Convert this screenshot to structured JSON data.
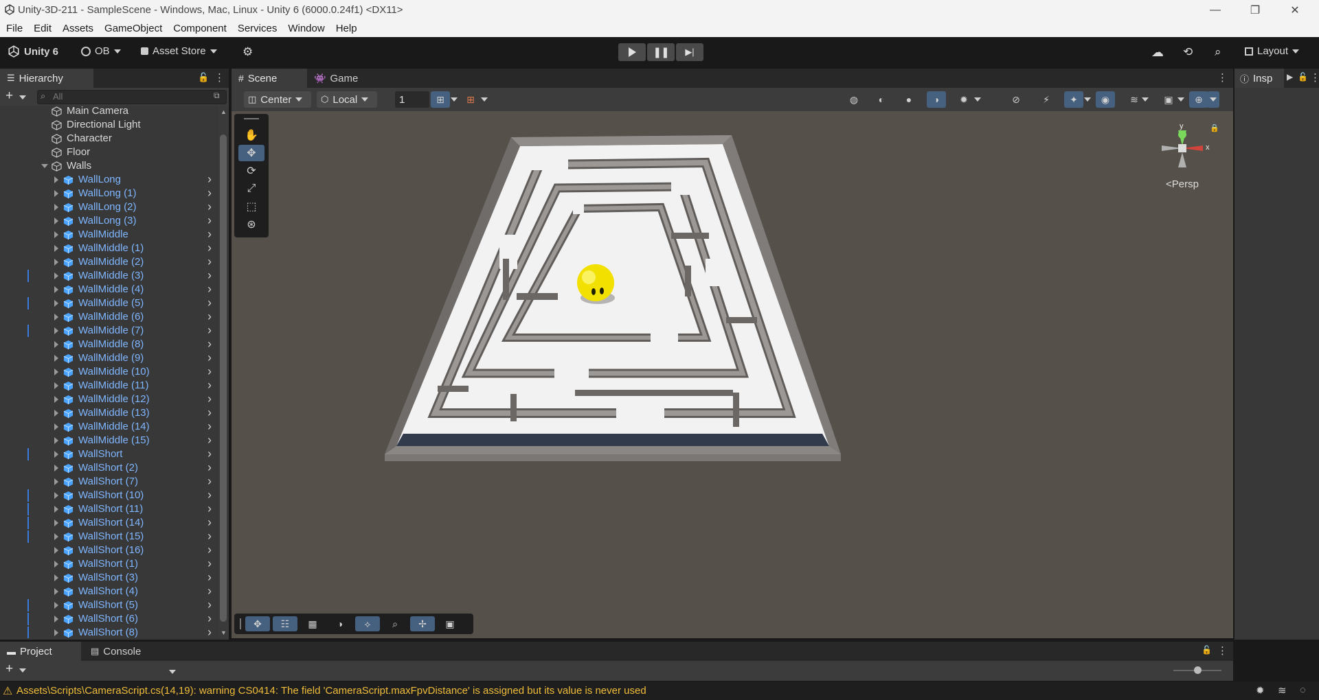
{
  "window": {
    "title": "Unity-3D-211 - SampleScene - Windows, Mac, Linux - Unity 6 (6000.0.24f1) <DX11>"
  },
  "menu": [
    "File",
    "Edit",
    "Assets",
    "GameObject",
    "Component",
    "Services",
    "Window",
    "Help"
  ],
  "toolbar": {
    "unity_label": "Unity 6",
    "account_label": "OB",
    "asset_store_label": "Asset Store",
    "layout_label": "Layout"
  },
  "hierarchy": {
    "tab_label": "Hierarchy",
    "search_placeholder": "All",
    "items": [
      {
        "name": "Main Camera",
        "depth": 1,
        "type": "object"
      },
      {
        "name": "Directional Light",
        "depth": 1,
        "type": "object"
      },
      {
        "name": "Character",
        "depth": 1,
        "type": "object"
      },
      {
        "name": "Floor",
        "depth": 1,
        "type": "object"
      },
      {
        "name": "Walls",
        "depth": 1,
        "type": "parent"
      },
      {
        "name": "WallLong",
        "depth": 2,
        "type": "prefab",
        "mark": false
      },
      {
        "name": "WallLong (1)",
        "depth": 2,
        "type": "prefab",
        "mark": false
      },
      {
        "name": "WallLong (2)",
        "depth": 2,
        "type": "prefab",
        "mark": false
      },
      {
        "name": "WallLong (3)",
        "depth": 2,
        "type": "prefab",
        "mark": false
      },
      {
        "name": "WallMiddle",
        "depth": 2,
        "type": "prefab",
        "mark": false
      },
      {
        "name": "WallMiddle (1)",
        "depth": 2,
        "type": "prefab",
        "mark": false
      },
      {
        "name": "WallMiddle (2)",
        "depth": 2,
        "type": "prefab",
        "mark": false
      },
      {
        "name": "WallMiddle (3)",
        "depth": 2,
        "type": "prefab",
        "mark": true
      },
      {
        "name": "WallMiddle (4)",
        "depth": 2,
        "type": "prefab",
        "mark": false
      },
      {
        "name": "WallMiddle (5)",
        "depth": 2,
        "type": "prefab",
        "mark": true
      },
      {
        "name": "WallMiddle (6)",
        "depth": 2,
        "type": "prefab",
        "mark": false
      },
      {
        "name": "WallMiddle (7)",
        "depth": 2,
        "type": "prefab",
        "mark": true
      },
      {
        "name": "WallMiddle (8)",
        "depth": 2,
        "type": "prefab",
        "mark": false
      },
      {
        "name": "WallMiddle (9)",
        "depth": 2,
        "type": "prefab",
        "mark": false
      },
      {
        "name": "WallMiddle (10)",
        "depth": 2,
        "type": "prefab",
        "mark": false
      },
      {
        "name": "WallMiddle (11)",
        "depth": 2,
        "type": "prefab",
        "mark": false
      },
      {
        "name": "WallMiddle (12)",
        "depth": 2,
        "type": "prefab",
        "mark": false
      },
      {
        "name": "WallMiddle (13)",
        "depth": 2,
        "type": "prefab",
        "mark": false
      },
      {
        "name": "WallMiddle (14)",
        "depth": 2,
        "type": "prefab",
        "mark": false
      },
      {
        "name": "WallMiddle (15)",
        "depth": 2,
        "type": "prefab",
        "mark": false
      },
      {
        "name": "WallShort",
        "depth": 2,
        "type": "prefab",
        "mark": true
      },
      {
        "name": "WallShort (2)",
        "depth": 2,
        "type": "prefab",
        "mark": false
      },
      {
        "name": "WallShort (7)",
        "depth": 2,
        "type": "prefab",
        "mark": false
      },
      {
        "name": "WallShort (10)",
        "depth": 2,
        "type": "prefab",
        "mark": true
      },
      {
        "name": "WallShort (11)",
        "depth": 2,
        "type": "prefab",
        "mark": true
      },
      {
        "name": "WallShort (14)",
        "depth": 2,
        "type": "prefab",
        "mark": true
      },
      {
        "name": "WallShort (15)",
        "depth": 2,
        "type": "prefab",
        "mark": true
      },
      {
        "name": "WallShort (16)",
        "depth": 2,
        "type": "prefab",
        "mark": false
      },
      {
        "name": "WallShort (1)",
        "depth": 2,
        "type": "prefab",
        "mark": false
      },
      {
        "name": "WallShort (3)",
        "depth": 2,
        "type": "prefab",
        "mark": false
      },
      {
        "name": "WallShort (4)",
        "depth": 2,
        "type": "prefab",
        "mark": false
      },
      {
        "name": "WallShort (5)",
        "depth": 2,
        "type": "prefab",
        "mark": true
      },
      {
        "name": "WallShort (6)",
        "depth": 2,
        "type": "prefab",
        "mark": true
      },
      {
        "name": "WallShort (8)",
        "depth": 2,
        "type": "prefab",
        "mark": true
      }
    ]
  },
  "scene": {
    "tab_scene": "Scene",
    "tab_game": "Game",
    "pivot_label": "Center",
    "space_label": "Local",
    "grid_size": "1",
    "persp_label": "<Persp",
    "gizmo_x": "x",
    "gizmo_y": "y"
  },
  "inspector": {
    "tab_label": "Insp"
  },
  "project": {
    "tab_project": "Project",
    "tab_console": "Console"
  },
  "status": {
    "message": "Assets\\Scripts\\CameraScript.cs(14,19): warning CS0414: The field 'CameraScript.maxFpvDistance' is assigned but its value is never used"
  },
  "colors": {
    "accent": "#46607f",
    "prefab_text": "#7fb6ff",
    "warning": "#f0bd3a",
    "character": "#f2e000"
  }
}
